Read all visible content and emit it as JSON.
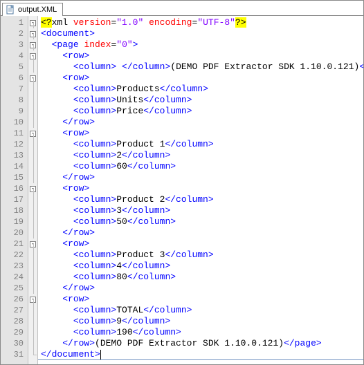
{
  "tab": {
    "filename": "output.XML"
  },
  "lines": [
    {
      "n": 1,
      "fold": "start",
      "kind": "pi"
    },
    {
      "n": 2,
      "fold": "start",
      "indent": 0,
      "open": "document"
    },
    {
      "n": 3,
      "fold": "start",
      "indent": 1,
      "open": "page",
      "attrs": [
        [
          "index",
          "0"
        ]
      ]
    },
    {
      "n": 4,
      "fold": "start",
      "indent": 2,
      "open": "row"
    },
    {
      "n": 5,
      "fold": "line",
      "indent": 3,
      "inline": true,
      "el": "column",
      "content": " ",
      "after_open": "row",
      "after_text": "(DEMO PDF Extractor SDK 1.10.0.121)"
    },
    {
      "n": 6,
      "fold": "start",
      "indent": 2,
      "open": "row"
    },
    {
      "n": 7,
      "fold": "line",
      "indent": 3,
      "inline": true,
      "el": "column",
      "content": "Products"
    },
    {
      "n": 8,
      "fold": "line",
      "indent": 3,
      "inline": true,
      "el": "column",
      "content": "Units"
    },
    {
      "n": 9,
      "fold": "line",
      "indent": 3,
      "inline": true,
      "el": "column",
      "content": "Price"
    },
    {
      "n": 10,
      "fold": "line",
      "indent": 2,
      "close": "row"
    },
    {
      "n": 11,
      "fold": "start",
      "indent": 2,
      "open": "row"
    },
    {
      "n": 12,
      "fold": "line",
      "indent": 3,
      "inline": true,
      "el": "column",
      "content": "Product 1"
    },
    {
      "n": 13,
      "fold": "line",
      "indent": 3,
      "inline": true,
      "el": "column",
      "content": "2"
    },
    {
      "n": 14,
      "fold": "line",
      "indent": 3,
      "inline": true,
      "el": "column",
      "content": "60"
    },
    {
      "n": 15,
      "fold": "line",
      "indent": 2,
      "close": "row"
    },
    {
      "n": 16,
      "fold": "start",
      "indent": 2,
      "open": "row"
    },
    {
      "n": 17,
      "fold": "line",
      "indent": 3,
      "inline": true,
      "el": "column",
      "content": "Product 2"
    },
    {
      "n": 18,
      "fold": "line",
      "indent": 3,
      "inline": true,
      "el": "column",
      "content": "3"
    },
    {
      "n": 19,
      "fold": "line",
      "indent": 3,
      "inline": true,
      "el": "column",
      "content": "50"
    },
    {
      "n": 20,
      "fold": "line",
      "indent": 2,
      "close": "row"
    },
    {
      "n": 21,
      "fold": "start",
      "indent": 2,
      "open": "row"
    },
    {
      "n": 22,
      "fold": "line",
      "indent": 3,
      "inline": true,
      "el": "column",
      "content": "Product 3"
    },
    {
      "n": 23,
      "fold": "line",
      "indent": 3,
      "inline": true,
      "el": "column",
      "content": "4"
    },
    {
      "n": 24,
      "fold": "line",
      "indent": 3,
      "inline": true,
      "el": "column",
      "content": "80"
    },
    {
      "n": 25,
      "fold": "line",
      "indent": 2,
      "close": "row"
    },
    {
      "n": 26,
      "fold": "start",
      "indent": 2,
      "open": "row"
    },
    {
      "n": 27,
      "fold": "line",
      "indent": 3,
      "inline": true,
      "el": "column",
      "content": "TOTAL"
    },
    {
      "n": 28,
      "fold": "line",
      "indent": 3,
      "inline": true,
      "el": "column",
      "content": "9"
    },
    {
      "n": 29,
      "fold": "line",
      "indent": 3,
      "inline": true,
      "el": "column",
      "content": "190"
    },
    {
      "n": 30,
      "fold": "line",
      "indent": 2,
      "close": "row",
      "tail_text": "(DEMO PDF Extractor SDK 1.10.0.121)",
      "tail_close": "page"
    },
    {
      "n": 31,
      "fold": "end",
      "indent": 0,
      "close": "document",
      "cursor_after": true
    }
  ],
  "pi": {
    "target": "xml",
    "attrs": [
      [
        "version",
        "1.0"
      ],
      [
        "encoding",
        "UTF-8"
      ]
    ]
  }
}
